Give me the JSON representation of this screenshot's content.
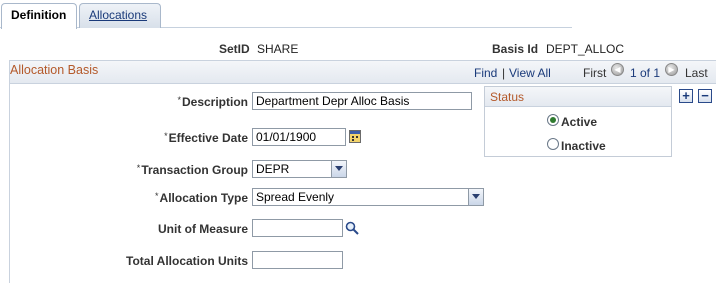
{
  "tabs": [
    {
      "label": "Definition",
      "active": true
    },
    {
      "label": "Allocations",
      "active": false
    }
  ],
  "header": {
    "setid_label": "SetID",
    "setid_value": "SHARE",
    "basis_id_label": "Basis Id",
    "basis_id_value": "DEPT_ALLOC"
  },
  "group": {
    "title": "Allocation Basis",
    "find_label": "Find",
    "separator": "|",
    "view_all_label": "View All",
    "first_label": "First",
    "page_info": "1 of 1",
    "last_label": "Last"
  },
  "form": {
    "description": {
      "label": "Description",
      "value": "Department Depr Alloc Basis"
    },
    "effective_date": {
      "label": "Effective Date",
      "value": "01/01/1900"
    },
    "transaction_group": {
      "label": "Transaction Group",
      "value": "DEPR"
    },
    "allocation_type": {
      "label": "Allocation Type",
      "value": "Spread Evenly"
    },
    "unit_of_measure": {
      "label": "Unit of Measure",
      "value": ""
    },
    "total_allocation_units": {
      "label": "Total Allocation Units",
      "value": ""
    }
  },
  "status": {
    "title": "Status",
    "options": [
      {
        "label": "Active",
        "selected": true
      },
      {
        "label": "Inactive",
        "selected": false
      }
    ]
  },
  "row_buttons": {
    "add": "+",
    "remove": "−"
  },
  "required_marker": "*",
  "icons": {
    "calendar": "calendar-icon",
    "lookup": "magnifier-icon",
    "prev": "previous-icon",
    "next": "next-icon"
  },
  "colors": {
    "group_title": "#b4592a",
    "link": "#1a3a7a",
    "radio_selected": "#2f7b2f"
  }
}
